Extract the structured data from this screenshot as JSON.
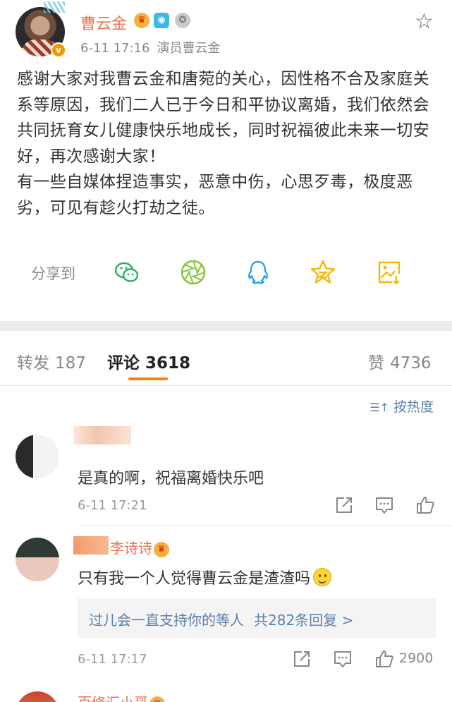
{
  "post": {
    "username": "曹云金",
    "time": "6-11 17:16",
    "source": "演员曹云金",
    "paragraphs": [
      "感谢大家对我曹云金和唐菀的关心，因性格不合及家庭关系等原因，我们二人已于今日和平协议离婚，我们依然会共同抚育女儿健康快乐地成长，同时祝福彼此未来一切安好，再次感谢大家！",
      "有一些自媒体捏造事实，恶意中伤，心思歹毒，极度恶劣，可见有趁火打劫之徒。"
    ],
    "verified_mark": "v"
  },
  "share": {
    "label": "分享到",
    "icons": [
      "wechat-icon",
      "moments-icon",
      "qq-icon",
      "qzone-icon",
      "save-image-icon"
    ]
  },
  "tabs": {
    "repost_label": "转发",
    "repost_count": "187",
    "comment_label": "评论",
    "comment_count": "3618",
    "like_label": "赞",
    "like_count": "4736"
  },
  "sort": {
    "label": "按热度"
  },
  "comments": [
    {
      "username": "",
      "text": "是真的啊，祝福离婚快乐吧",
      "time": "6-11 17:21",
      "like_count": ""
    },
    {
      "username": "李诗诗",
      "text": "只有我一个人觉得曹云金是渣渣吗",
      "time": "6-11 17:17",
      "like_count": "2900",
      "reply_preview": "过儿会一直支持你的等人",
      "reply_count": "共282条回复 >"
    },
    {
      "username": "百修汇小哥"
    }
  ],
  "colors": {
    "accent_orange": "#ff8200",
    "username_orange": "#eb7350",
    "link_blue": "#5d7fa8",
    "share_green": "#2aae67",
    "share_lightgreen": "#8cc63f",
    "share_blue": "#2aa4e3",
    "share_yellow": "#f5b800"
  }
}
